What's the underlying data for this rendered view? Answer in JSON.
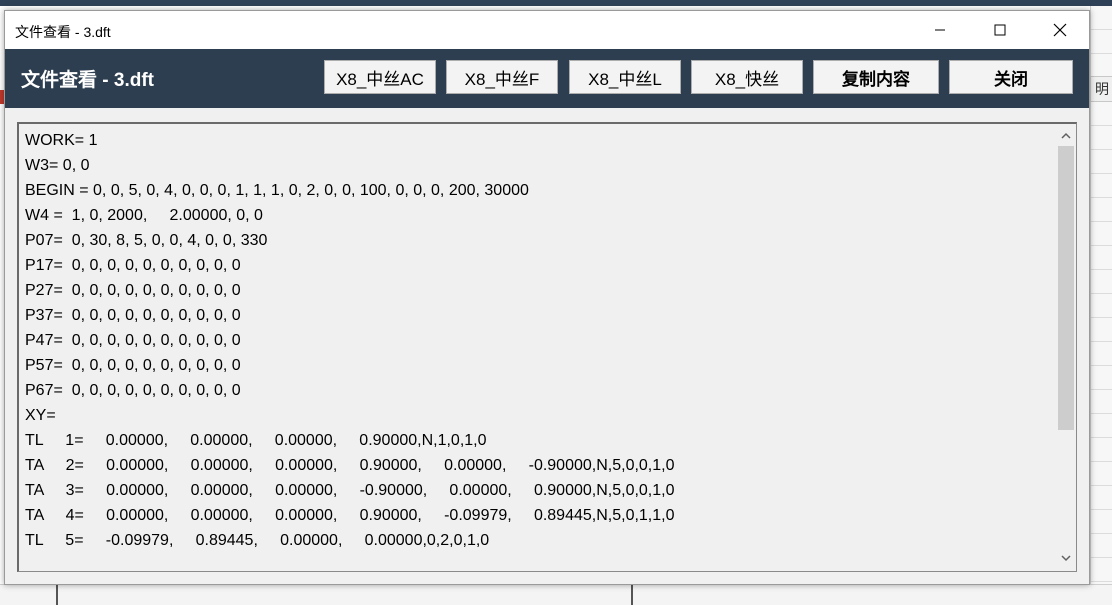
{
  "window": {
    "title": "文件查看 - 3.dft",
    "header_title": "文件查看 - 3.dft"
  },
  "toolbar": {
    "buttons": [
      {
        "label": "X8_中丝AC"
      },
      {
        "label": "X8_中丝F"
      },
      {
        "label": "X8_中丝L"
      },
      {
        "label": "X8_快丝"
      },
      {
        "label": "复制内容"
      },
      {
        "label": "关闭"
      }
    ]
  },
  "background": {
    "header_cell": "明"
  },
  "content": {
    "lines": [
      "WORK= 1",
      "W3= 0, 0",
      "BEGIN = 0, 0, 5, 0, 4, 0, 0, 0, 1, 1, 1, 0, 2, 0, 0, 100, 0, 0, 0, 200, 30000",
      "W4 =  1, 0, 2000,     2.00000, 0, 0",
      "P07=  0, 30, 8, 5, 0, 0, 4, 0, 0, 330",
      "P17=  0, 0, 0, 0, 0, 0, 0, 0, 0, 0",
      "P27=  0, 0, 0, 0, 0, 0, 0, 0, 0, 0",
      "P37=  0, 0, 0, 0, 0, 0, 0, 0, 0, 0",
      "P47=  0, 0, 0, 0, 0, 0, 0, 0, 0, 0",
      "P57=  0, 0, 0, 0, 0, 0, 0, 0, 0, 0",
      "P67=  0, 0, 0, 0, 0, 0, 0, 0, 0, 0",
      "XY=",
      "TL     1=     0.00000,     0.00000,     0.00000,     0.90000,N,1,0,1,0",
      "TA     2=     0.00000,     0.00000,     0.00000,     0.90000,     0.00000,     -0.90000,N,5,0,0,1,0",
      "TA     3=     0.00000,     0.00000,     0.00000,     -0.90000,     0.00000,     0.90000,N,5,0,0,1,0",
      "TA     4=     0.00000,     0.00000,     0.00000,     0.90000,     -0.09979,     0.89445,N,5,0,1,1,0",
      "TL     5=     -0.09979,     0.89445,     0.00000,     0.00000,0,2,0,1,0"
    ]
  },
  "icons": {
    "minimize": "minimize-icon",
    "maximize": "maximize-icon",
    "close": "close-icon",
    "scroll_up": "chevron-up-icon",
    "scroll_down": "chevron-down-icon"
  }
}
